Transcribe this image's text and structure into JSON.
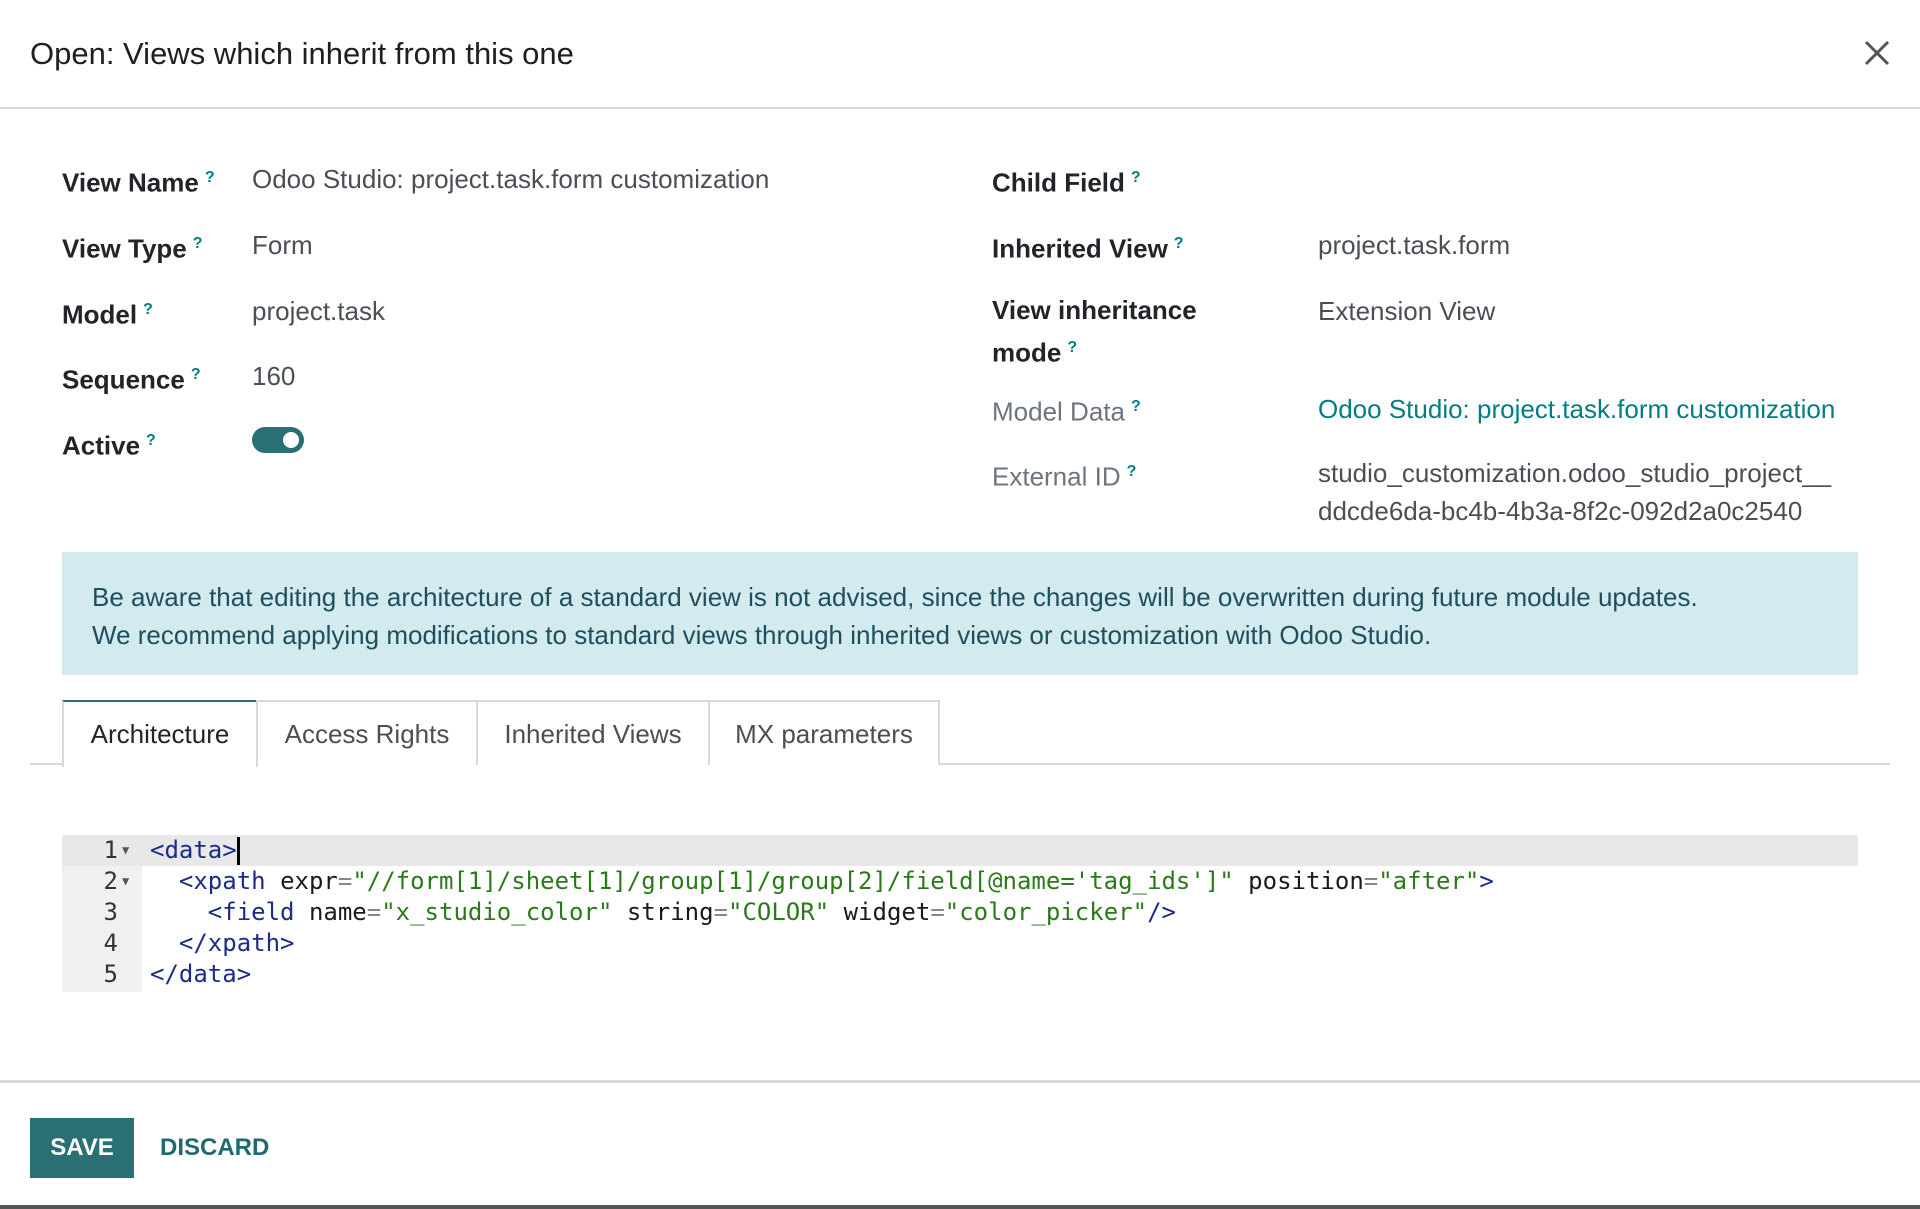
{
  "dialog": {
    "title": "Open: Views which inherit from this one",
    "close_icon": "close-icon"
  },
  "help_marker": "?",
  "fields_left": [
    {
      "label": "View Name",
      "value": "Odoo Studio: project.task.form customization"
    },
    {
      "label": "View Type",
      "value": "Form"
    },
    {
      "label": "Model",
      "value": "project.task"
    },
    {
      "label": "Sequence",
      "value": "160"
    },
    {
      "label": "Active",
      "value": true
    }
  ],
  "fields_right": [
    {
      "label": "Child Field",
      "value": ""
    },
    {
      "label": "Inherited View",
      "value": "project.task.form"
    },
    {
      "label_line1": "View inheritance",
      "label_line2": "mode",
      "value": "Extension View"
    },
    {
      "label": "Model Data",
      "value": "Odoo Studio: project.task.form customization"
    },
    {
      "label": "External ID",
      "value_line1": "studio_customization.odoo_studio_project__",
      "value_line2": "ddcde6da-bc4b-4b3a-8f2c-092d2a0c2540"
    }
  ],
  "alert": {
    "line1": "Be aware that editing the architecture of a standard view is not advised, since the changes will be overwritten during future module updates.",
    "line2": "We recommend applying modifications to standard views through inherited views or customization with Odoo Studio."
  },
  "tabs": [
    {
      "label": "Architecture",
      "active": true
    },
    {
      "label": "Access Rights",
      "active": false
    },
    {
      "label": "Inherited Views",
      "active": false
    },
    {
      "label": "MX parameters",
      "active": false
    }
  ],
  "code": {
    "line_numbers": [
      "1",
      "2",
      "3",
      "4",
      "5"
    ],
    "l1_tag": "<data>",
    "l2_open": "<xpath",
    "l2_attr1": "expr",
    "l2_val1": "\"//form[1]/sheet[1]/group[1]/group[2]/field[@name='tag_ids']\"",
    "l2_attr2": "position",
    "l2_val2": "\"after\"",
    "l2_close": ">",
    "l3_open": "<field",
    "l3_attr1": "name",
    "l3_val1": "\"x_studio_color\"",
    "l3_attr2": "string",
    "l3_val2": "\"COLOR\"",
    "l3_attr3": "widget",
    "l3_val3": "\"color_picker\"",
    "l3_close": "/>",
    "l4_tag": "</xpath>",
    "l5_tag": "</data>",
    "eq": "="
  },
  "footer": {
    "save_label": "SAVE",
    "discard_label": "DISCARD"
  },
  "colors": {
    "accent": "#2a6f74",
    "link": "#017e84",
    "alert_bg": "#d3eaef"
  }
}
